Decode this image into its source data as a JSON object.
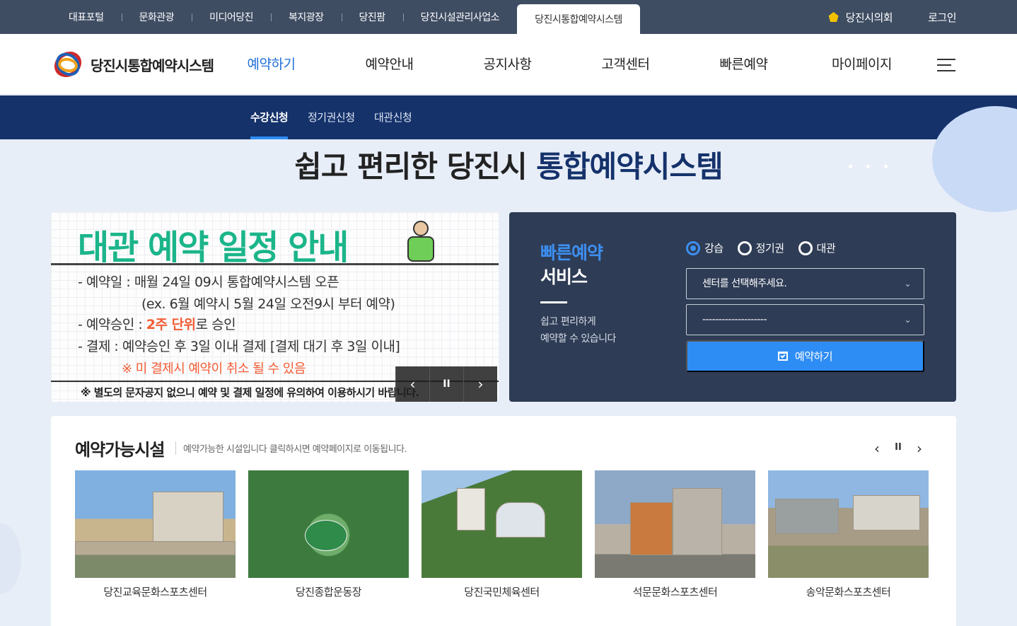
{
  "topbar": {
    "links": [
      "대표포털",
      "문화관광",
      "미디어당진",
      "복지광장",
      "당진팜",
      "당진시설관리사업소"
    ],
    "active_link": "당진시통합예약시스템",
    "council": "당진시의회",
    "login": "로그인"
  },
  "header": {
    "logo_text": "당진시통합예약시스템",
    "nav": [
      "예약하기",
      "예약안내",
      "공지사항",
      "고객센터",
      "빠른예약",
      "마이페이지"
    ],
    "active_nav": "예약하기"
  },
  "subnav": {
    "items": [
      "수강신청",
      "정기권신청",
      "대관신청"
    ],
    "active": "수강신청"
  },
  "hero": {
    "title_plain": "쉽고 편리한 당진시 ",
    "title_bold": "통합예약시스템"
  },
  "banner": {
    "title": "대관 예약 일정 안내",
    "line1": "- 예약일 :  매월 24일 09시 통합예약시스템 오픈",
    "line2": "(ex. 6월 예약시 5월 24일 오전9시 부터 예약)",
    "line3_pre": "- 예약승인 : ",
    "line3_hi": "2주 단위",
    "line3_post": "로 승인",
    "line4": "- 결제 : 예약승인 후 3일 이내 결제 [결제 대기 후 3일 이내]",
    "warn": "※ 미 결제시 예약이 취소 될 수 있음",
    "note": "※  별도의 문자공지 없으니 예약 및 결제 일정에 유의하여 이용하시기 바랍니다.",
    "controls": {
      "prev": "‹",
      "pause": "II",
      "next": "›"
    }
  },
  "quick": {
    "title1": "빠른예약",
    "title2": "서비스",
    "desc1": "쉽고 편리하게",
    "desc2": "예약할 수 있습니다",
    "radios": [
      "강습",
      "정기권",
      "대관"
    ],
    "selected_radio": "강습",
    "select1": "센터를 선택해주세요.",
    "select2": "--------------------",
    "button": "예약하기"
  },
  "facilities": {
    "title": "예약가능시설",
    "subtitle": "예약가능한 시설입니다 클릭하시면 예약페이지로 이동됩니다.",
    "controls": {
      "prev": "‹",
      "pause": "II",
      "next": "›"
    },
    "items": [
      {
        "name": "당진교육문화스포츠센터"
      },
      {
        "name": "당진종합운동장"
      },
      {
        "name": "당진국민체육센터"
      },
      {
        "name": "석문문화스포츠센터"
      },
      {
        "name": "송악문화스포츠센터"
      }
    ]
  },
  "colors": {
    "topbar": "#3f4d63",
    "subnav": "#15326b",
    "accent": "#2e8df5",
    "banner_title": "#1bb58a",
    "quick_bg": "#2e3c55"
  }
}
